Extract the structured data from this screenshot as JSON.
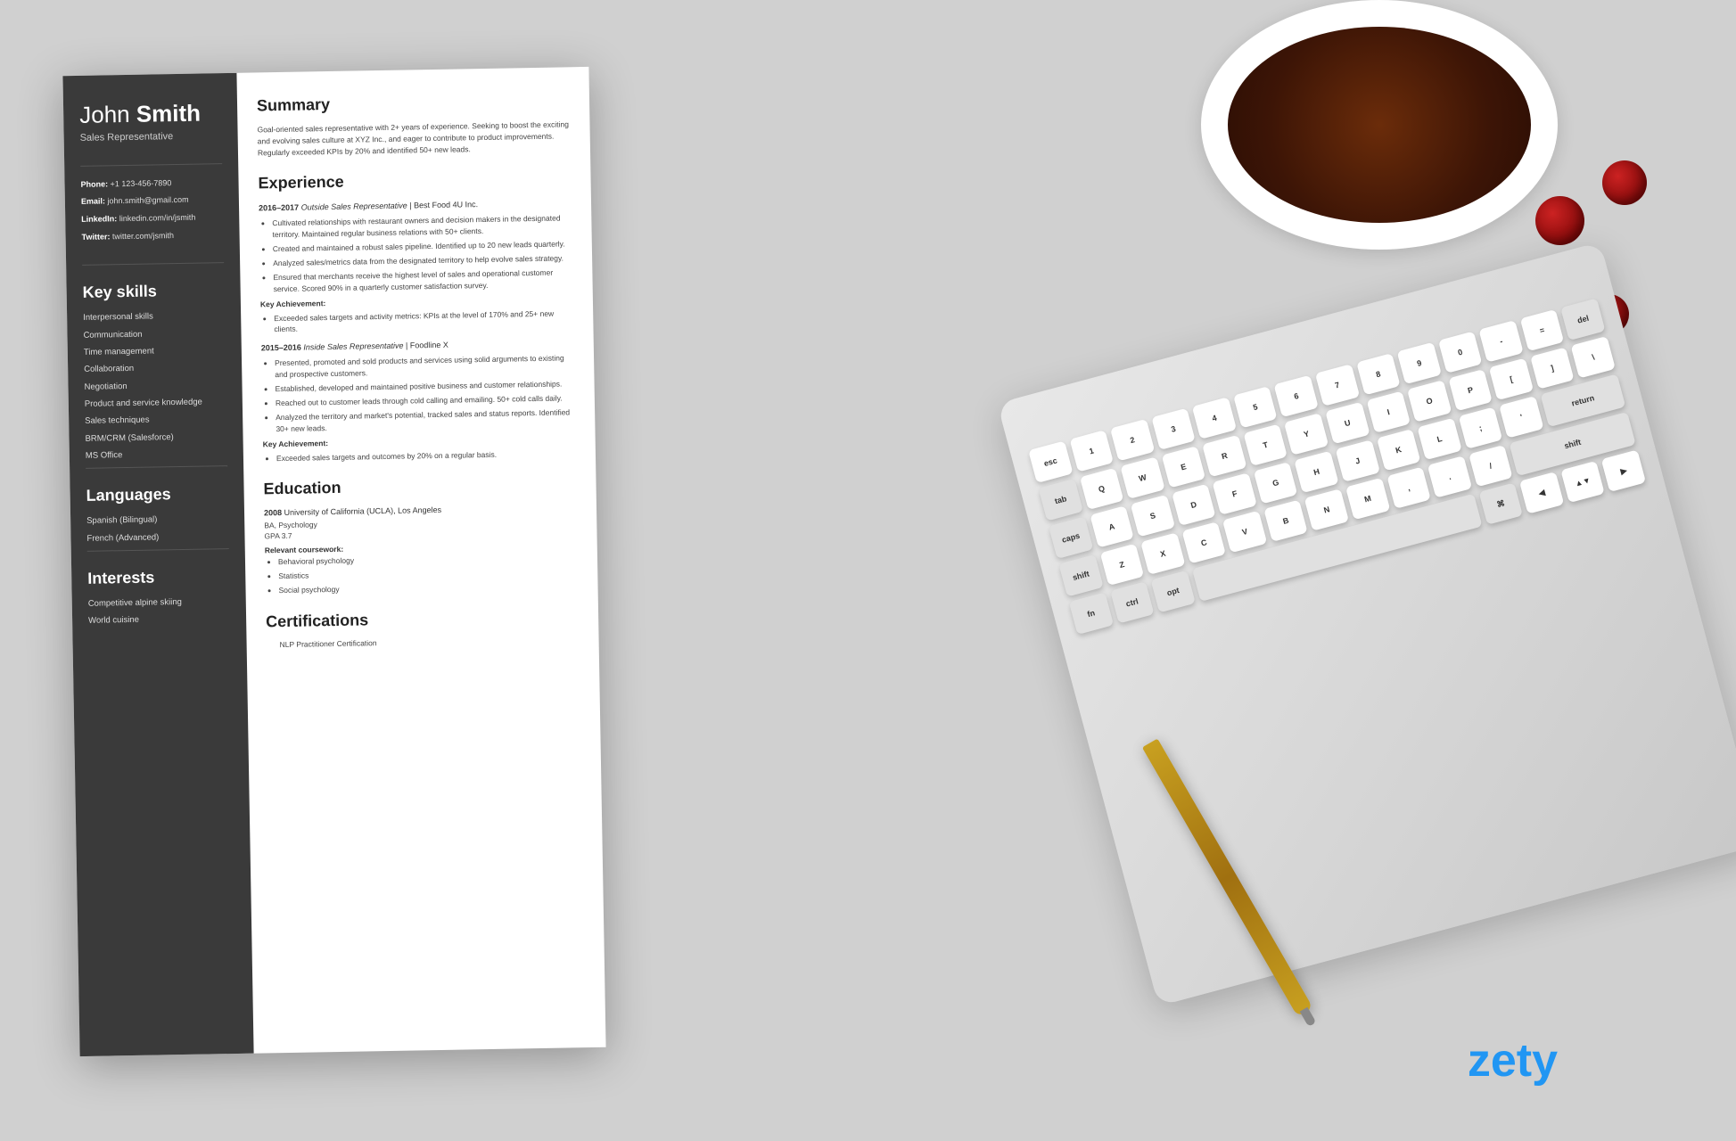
{
  "background": {
    "color": "#d0d0d0"
  },
  "zety": {
    "logo": "zety"
  },
  "resume": {
    "sidebar": {
      "name_regular": "John ",
      "name_bold": "Smith",
      "title": "Sales Representative",
      "contact": {
        "phone_label": "Phone:",
        "phone_value": "+1 123-456-7890",
        "email_label": "Email:",
        "email_value": "john.smith@gmail.com",
        "linkedin_label": "LinkedIn:",
        "linkedin_value": "linkedin.com/in/jsmith",
        "twitter_label": "Twitter:",
        "twitter_value": "twitter.com/jsmith"
      },
      "skills_heading": "Key skills",
      "skills": [
        "Interpersonal skills",
        "Communication",
        "Time management",
        "Collaboration",
        "Negotiation",
        "Product and service knowledge",
        "Sales techniques",
        "BRM/CRM (Salesforce)",
        "MS Office"
      ],
      "languages_heading": "Languages",
      "languages": [
        "Spanish (Bilingual)",
        "French (Advanced)"
      ],
      "interests_heading": "Interests",
      "interests": [
        "Competitive alpine skiing",
        "World cuisine"
      ]
    },
    "main": {
      "summary_heading": "Summary",
      "summary_text": "Goal-oriented sales representative with 2+ years of experience. Seeking to boost the exciting and evolving sales culture at XYZ Inc., and eager to contribute to product improvements. Regularly exceeded KPIs by 20% and identified 50+ new leads.",
      "experience_heading": "Experience",
      "jobs": [
        {
          "years": "2016–2017",
          "title": "Outside Sales Representative",
          "company": "Best Food 4U Inc.",
          "bullets": [
            "Cultivated relationships with restaurant owners and decision makers in the designated territory. Maintained regular business relations with 50+ clients.",
            "Created and maintained a robust sales pipeline. Identified up to 20 new leads quarterly.",
            "Analyzed sales/metrics data from the designated territory to help evolve sales strategy.",
            "Ensured that merchants receive the highest level of sales and operational customer service. Scored 90% in a quarterly customer satisfaction survey."
          ],
          "achievement_label": "Key Achievement:",
          "achievement": "Exceeded sales targets and activity metrics: KPIs at the level of 170% and 25+ new clients."
        },
        {
          "years": "2015–2016",
          "title": "Inside Sales Representative",
          "company": "Foodline X",
          "bullets": [
            "Presented, promoted and sold products and services using solid arguments to existing and prospective customers.",
            "Established, developed and maintained positive business and customer relationships.",
            "Reached out to customer leads through cold calling and emailing. 50+ cold calls daily.",
            "Analyzed the territory and market's potential, tracked sales and status reports. Identified 30+ new leads."
          ],
          "achievement_label": "Key Achievement:",
          "achievement": "Exceeded sales targets and outcomes by 20% on a regular basis."
        }
      ],
      "education_heading": "Education",
      "education": [
        {
          "year": "2008",
          "school": "University of California (UCLA), Los Angeles",
          "degree": "BA, Psychology",
          "gpa": "GPA 3.7",
          "coursework_label": "Relevant coursework:",
          "coursework": [
            "Behavioral psychology",
            "Statistics",
            "Social psychology"
          ]
        }
      ],
      "certifications_heading": "Certifications",
      "certifications": [
        "NLP Practitioner Certification"
      ]
    }
  }
}
